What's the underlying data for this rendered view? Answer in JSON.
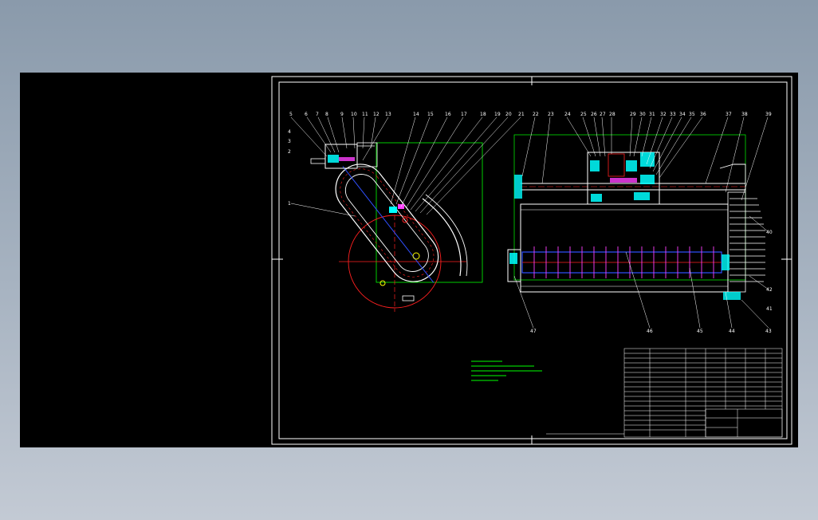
{
  "drawing": {
    "part_numbers_left": [
      "5",
      "6",
      "7",
      "8",
      "9",
      "10",
      "11",
      "12",
      "13",
      "14",
      "15",
      "16",
      "17",
      "18",
      "19",
      "20",
      "21"
    ],
    "part_numbers_right": [
      "22",
      "23",
      "24",
      "25",
      "26",
      "27",
      "28",
      "29",
      "30",
      "31",
      "32",
      "33",
      "34",
      "35",
      "36",
      "37",
      "38",
      "39",
      "40"
    ],
    "part_numbers_side": [
      "4",
      "3",
      "2",
      "1"
    ],
    "part_numbers_bottom": [
      "47",
      "46",
      "45",
      "44",
      "43",
      "42",
      "41"
    ],
    "colors": {
      "background": "#000000",
      "frame": "#ffffff",
      "green": "#00ff00",
      "red": "#ff2020",
      "cyan": "#00ffff",
      "blue": "#3050ff",
      "magenta": "#ff40ff",
      "yellow": "#ffff00"
    }
  }
}
